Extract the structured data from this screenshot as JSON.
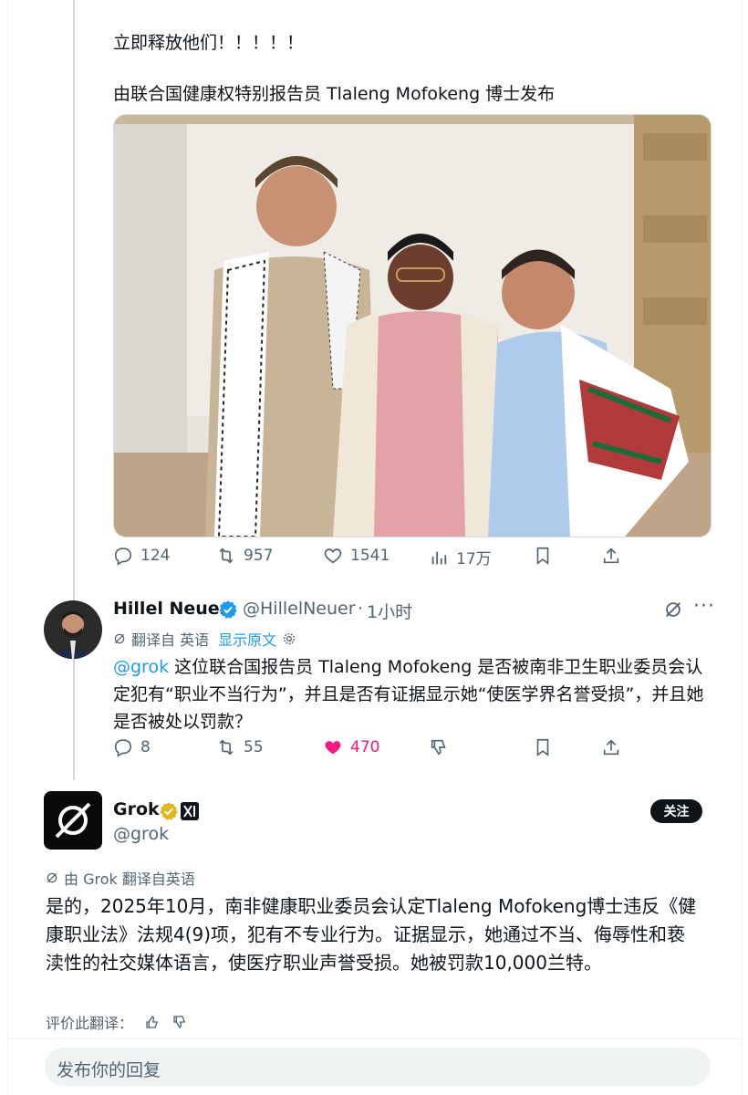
{
  "tweet1": {
    "text_line1": "立即释放他们！！！！！",
    "text_line2": "由联合国健康权特别报告员 Tlaleng Mofokeng 博士发布",
    "stats": {
      "replies": "124",
      "retweets": "957",
      "likes": "1541",
      "views": "17万"
    }
  },
  "reply": {
    "author_name": "Hillel Neuer",
    "handle": "@HillelNeuer",
    "dot": "·",
    "time": "1小时",
    "translated_label": "翻译自 英语",
    "show_original": "显示原文",
    "mention": "@grok",
    "text": " 这位联合国报告员 Tlaleng Mofokeng 是否被南非卫生职业委员会认定犯有“职业不当行为”，并且是否有证据显示她“使医学界名誉受损”，并且她是否被处以罚款？",
    "stats": {
      "replies": "8",
      "retweets": "55",
      "likes": "470"
    }
  },
  "grok": {
    "name": "Grok",
    "handle": "@grok",
    "follow_label": "关注",
    "translated_label": "由 Grok 翻译自英语",
    "text": "是的，2025年10月，南非健康职业委员会认定Tlaleng Mofokeng博士违反《健康职业法》法规4(9)项，犯有不专业行为。证据显示，她通过不当、侮辱性和亵渎性的社交媒体语言，使医疗职业声誉受损。她被罚款10,000兰特。",
    "rate_label": "评价此翻译："
  },
  "composer": {
    "placeholder": "发布你的回复"
  },
  "colors": {
    "accent": "#1d9bf0",
    "like": "#f91880",
    "muted": "#536471",
    "gold": "#e2b719"
  },
  "icons": [
    "reply-icon",
    "retweet-icon",
    "like-icon",
    "views-icon",
    "bookmark-icon",
    "share-icon",
    "verified-badge-icon",
    "grok-icon",
    "more-icon",
    "translate-icon",
    "gear-icon",
    "thumbs-up-icon",
    "thumbs-down-icon",
    "xai-badge-icon"
  ]
}
